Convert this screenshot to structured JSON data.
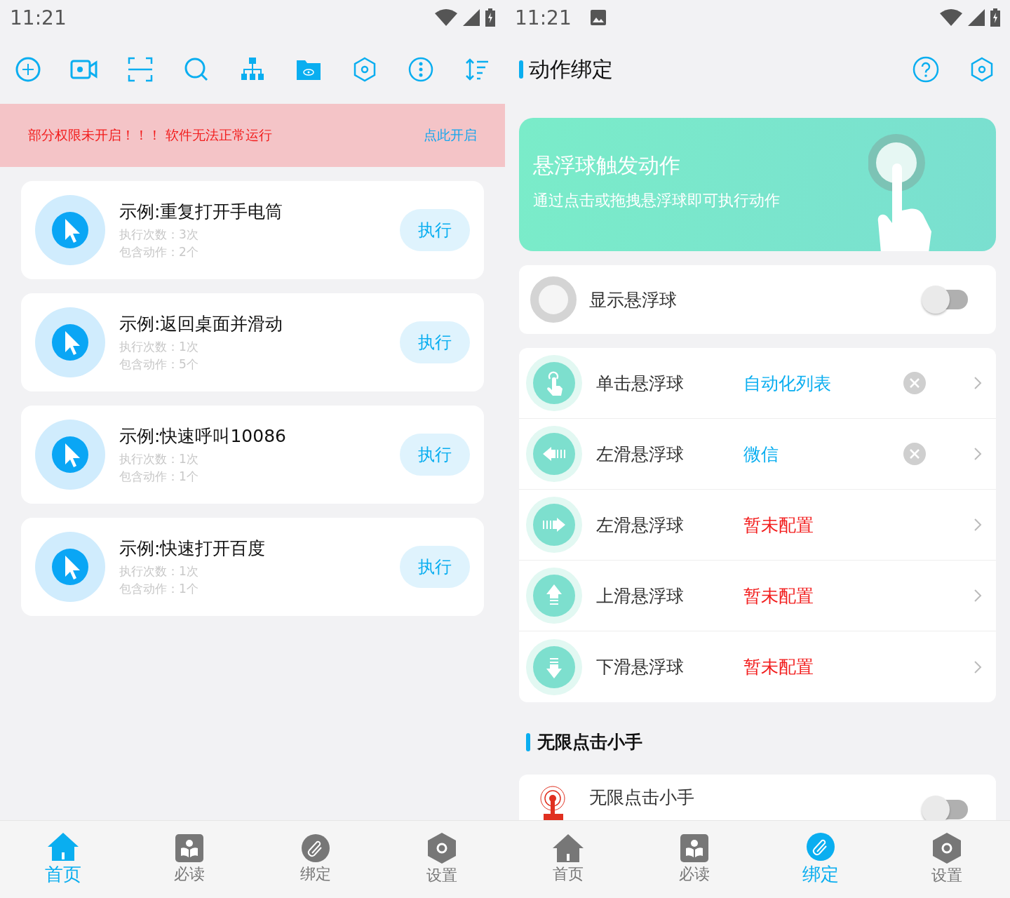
{
  "left": {
    "status_bar": {
      "time": "11:21"
    },
    "alert": {
      "message": "部分权限未开启！！！ 软件无法正常运行",
      "action": "点此开启"
    },
    "tasks": [
      {
        "title": "示例:重复打开手电筒",
        "runs": "执行次数：3次",
        "actions": "包含动作：2个",
        "button": "执行"
      },
      {
        "title": "示例:返回桌面并滑动",
        "runs": "执行次数：1次",
        "actions": "包含动作：5个",
        "button": "执行"
      },
      {
        "title": "示例:快速呼叫10086",
        "runs": "执行次数：1次",
        "actions": "包含动作：1个",
        "button": "执行"
      },
      {
        "title": "示例:快速打开百度",
        "runs": "执行次数：1次",
        "actions": "包含动作：1个",
        "button": "执行"
      }
    ],
    "nav": [
      {
        "kind": "home",
        "label": "首页",
        "selected": true
      },
      {
        "kind": "read",
        "label": "必读",
        "selected": false
      },
      {
        "kind": "bind",
        "label": "绑定",
        "selected": false
      },
      {
        "kind": "settings",
        "label": "设置",
        "selected": false
      }
    ]
  },
  "right": {
    "status_bar": {
      "time": "11:21"
    },
    "title": "动作绑定",
    "banner": {
      "title": "悬浮球触发动作",
      "subtitle": "通过点击或拖拽悬浮球即可执行动作"
    },
    "float_ball": {
      "label": "显示悬浮球",
      "on": false
    },
    "gestures": [
      {
        "kind": "tap",
        "name": "单击悬浮球",
        "target": "自动化列表",
        "configured": true
      },
      {
        "kind": "left",
        "name": "左滑悬浮球",
        "target": "微信",
        "configured": true
      },
      {
        "kind": "right",
        "name": "左滑悬浮球",
        "target": "暂未配置",
        "configured": false
      },
      {
        "kind": "up",
        "name": "上滑悬浮球",
        "target": "暂未配置",
        "configured": false
      },
      {
        "kind": "down",
        "name": "下滑悬浮球",
        "target": "暂未配置",
        "configured": false
      }
    ],
    "section_title": "无限点击小手",
    "clicker": {
      "label": "无限点击小手",
      "on": false
    },
    "nav": [
      {
        "kind": "home",
        "label": "首页",
        "selected": false
      },
      {
        "kind": "read",
        "label": "必读",
        "selected": false
      },
      {
        "kind": "bind",
        "label": "绑定",
        "selected": true
      },
      {
        "kind": "settings",
        "label": "设置",
        "selected": false
      }
    ]
  }
}
